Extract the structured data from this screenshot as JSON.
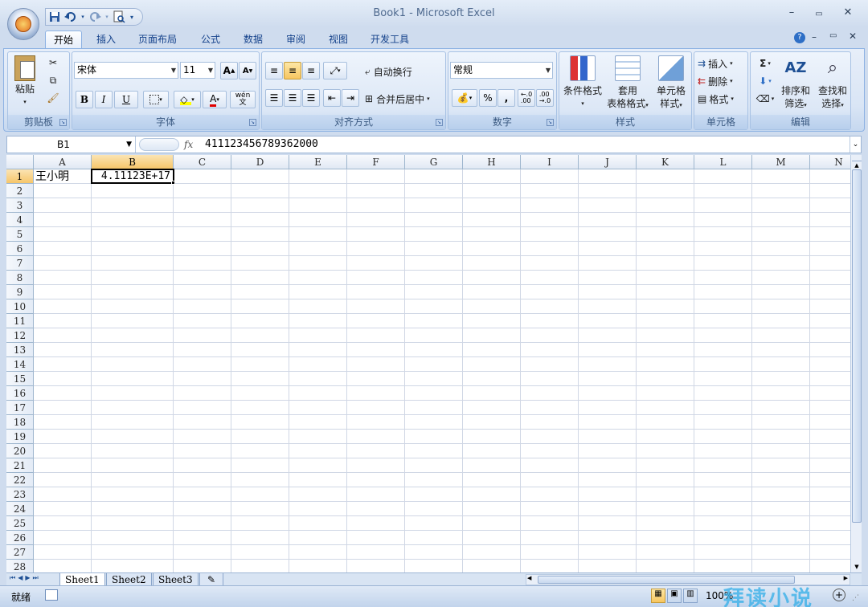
{
  "window": {
    "title": "Book1 - Microsoft Excel"
  },
  "qat": {
    "save_icon": "save-icon",
    "undo_icon": "undo-icon",
    "redo_icon": "redo-icon",
    "preview_icon": "print-preview-icon"
  },
  "tabs": [
    "开始",
    "插入",
    "页面布局",
    "公式",
    "数据",
    "审阅",
    "视图",
    "开发工具"
  ],
  "ribbon": {
    "clipboard": {
      "label": "剪贴板",
      "paste": "粘贴"
    },
    "font": {
      "label": "字体",
      "name": "宋体",
      "size": "11",
      "bold": "B",
      "italic": "I",
      "underline": "U",
      "grow": "A",
      "shrink": "A",
      "color_letter": "A",
      "wen": "wén\n文"
    },
    "alignment": {
      "label": "对齐方式",
      "wrap": "自动换行",
      "merge": "合并后居中"
    },
    "number": {
      "label": "数字",
      "format": "常规",
      "percent": "%",
      "comma": ",",
      "inc": "←.0\n.00",
      "dec": ".00\n→.0"
    },
    "styles": {
      "label": "样式",
      "cond": "条件格式",
      "table1": "套用",
      "table2": "表格格式",
      "cell1": "单元格",
      "cell2": "样式"
    },
    "cells": {
      "label": "单元格",
      "insert": "插入",
      "delete": "删除",
      "format": "格式"
    },
    "editing": {
      "label": "编辑",
      "sort1": "排序和",
      "sort2": "筛选",
      "find1": "查找和",
      "find2": "选择",
      "sigma": "Σ"
    }
  },
  "formula_bar": {
    "name_box": "B1",
    "fx": "fx",
    "value": "411123456789362000"
  },
  "grid": {
    "columns": [
      "A",
      "B",
      "C",
      "D",
      "E",
      "F",
      "G",
      "H",
      "I",
      "J",
      "K",
      "L",
      "M",
      "N"
    ],
    "rows": [
      "1",
      "2",
      "3",
      "4",
      "5",
      "6",
      "7",
      "8",
      "9",
      "10",
      "11",
      "12",
      "13",
      "14",
      "15",
      "16",
      "17",
      "18",
      "19",
      "20",
      "21",
      "22",
      "23",
      "24",
      "25",
      "26",
      "27",
      "28"
    ],
    "selected_column": "B",
    "selected_row": "1",
    "cells": {
      "A1": "王小明",
      "B1": "4.11123E+17"
    }
  },
  "sheets": [
    "Sheet1",
    "Sheet2",
    "Sheet3"
  ],
  "status": {
    "ready": "就绪",
    "zoom": "100%",
    "watermark": "拜读小说"
  }
}
